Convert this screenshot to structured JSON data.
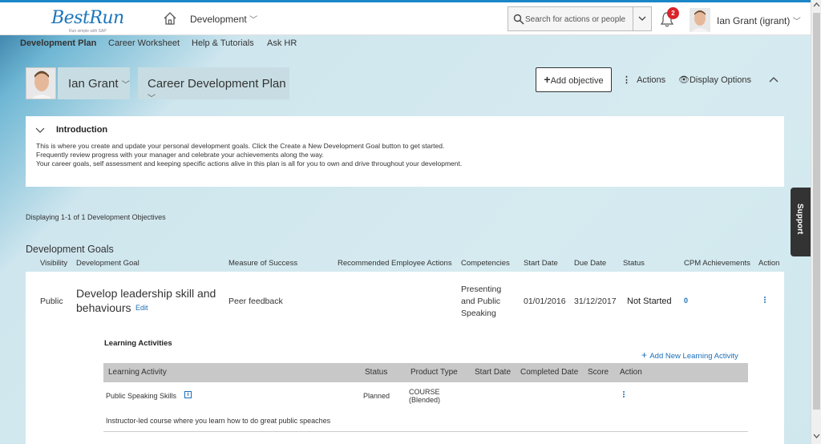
{
  "header": {
    "logo_text": "BestRun",
    "logo_tagline": "Run simple with SAP",
    "module": "Development",
    "search_placeholder": "Search for actions or people",
    "notification_count": "2",
    "user": "Ian Grant (igrant)"
  },
  "subnav": [
    "Development Plan",
    "Career Worksheet",
    "Help & Tutorials",
    "Ask HR"
  ],
  "toolbar": {
    "person": "Ian Grant",
    "plan": "Career Development Plan",
    "add_objective": "Add objective",
    "actions": "Actions",
    "display_options": "Display Options"
  },
  "intro": {
    "title": "Introduction",
    "lines": [
      "This is where you create and update your personal development goals. Click the Create a New Development Goal button to get started.",
      "Frequently review progress with your manager and celebrate your achievements along the way.",
      "Your career goals, self assessment and keeping specific actions alive in this plan is all for you to own and drive throughout your development."
    ]
  },
  "displaying": "Displaying 1-1 of 1 Development Objectives",
  "goals": {
    "title": "Development Goals",
    "columns": [
      "Visibility",
      "Development Goal",
      "Measure of Success",
      "Recommended Employee Actions",
      "Competencies",
      "Start Date",
      "Due Date",
      "Status",
      "CPM Achievements",
      "Action"
    ],
    "row": {
      "visibility": "Public",
      "goal_line1": "Develop leadership skill and",
      "goal_line2": "behaviours",
      "edit": "Edit",
      "measure": "Peer feedback",
      "competency_lines": [
        "Presenting",
        "and Public",
        "Speaking"
      ],
      "start_date": "01/01/2016",
      "due_date": "31/12/2017",
      "status": "Not Started",
      "cpm": "0"
    }
  },
  "learning": {
    "title": "Learning Activities",
    "add_label": "Add New Learning Activity",
    "columns": [
      "Learning Activity",
      "Status",
      "Product Type",
      "Start Date",
      "Completed Date",
      "Score",
      "Action"
    ],
    "row": {
      "activity": "Public Speaking Skills",
      "status": "Planned",
      "product_type_line1": "COURSE",
      "product_type_line2": "(Blended)",
      "description": "Instructor-led course where you learn how to do great public speaches"
    }
  },
  "support": "Support"
}
